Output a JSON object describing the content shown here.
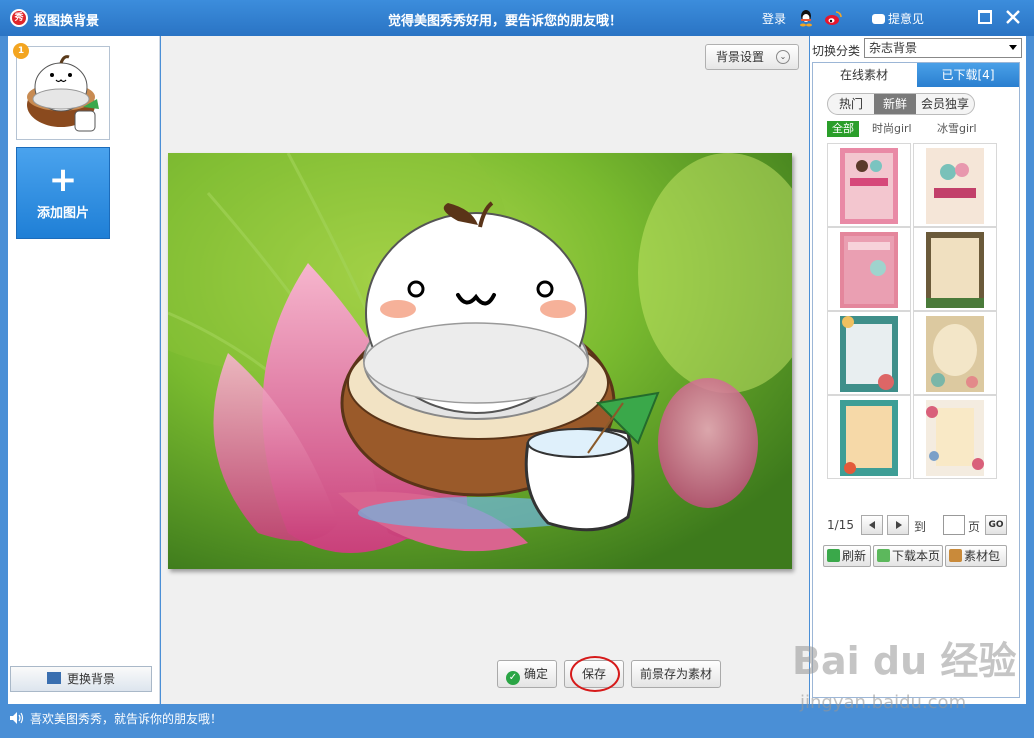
{
  "titlebar": {
    "app_icon_text": "秀",
    "app_title": "抠图换背景",
    "slogan": "觉得美图秀秀好用，要告诉您的朋友哦！",
    "login": "登录",
    "feedback": "提意见"
  },
  "left": {
    "thumb_badge": "1",
    "add_plus": "+",
    "add_label": "添加图片",
    "change_bg_label": "更换背景"
  },
  "center": {
    "bg_settings_label": "背景设置",
    "bg_settings_chevron": "⌄",
    "confirm_label": "确定",
    "confirm_check": "✓",
    "save_label": "保存",
    "save_foreground_label": "前景存为素材"
  },
  "right": {
    "category_label": "切换分类",
    "category_value": "杂志背景",
    "tabs": [
      {
        "label": "在线素材",
        "active": true
      },
      {
        "label": "已下载[4]",
        "active": false
      }
    ],
    "subtabs": [
      {
        "label": "热门"
      },
      {
        "label": "新鲜"
      },
      {
        "label": "会员独享"
      }
    ],
    "filters": [
      {
        "label": "全部"
      },
      {
        "label": "时尚girl"
      },
      {
        "label": "冰雪girl"
      }
    ],
    "pager": {
      "current": "1/15",
      "to_label": "到",
      "page_label": "页",
      "go_label": "GO",
      "page_input": ""
    },
    "actions": {
      "refresh": "刷新",
      "download_page": "下载本页",
      "package": "素材包"
    }
  },
  "status": {
    "text": "喜欢美图秀秀，就告诉你的朋友哦！"
  },
  "watermark": {
    "logo": "Bai du 经验",
    "url": "jingyan.baidu.com"
  },
  "colors": {
    "titlebar": "#2a74c4",
    "frame": "#4a8fd6",
    "add_button": "#1f7fd6",
    "filter_active": "#2a9e2a",
    "save_highlight": "#d61a1a"
  }
}
